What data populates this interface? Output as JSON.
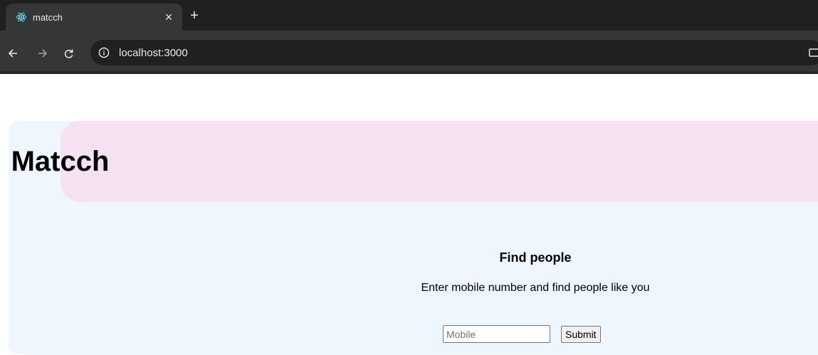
{
  "browser": {
    "tab": {
      "title": "matcch",
      "favicon": "react-icon",
      "close_glyph": "×"
    },
    "new_tab_glyph": "+",
    "nav": {
      "back_glyph": "←",
      "forward_glyph": "→",
      "reload_glyph": "C"
    },
    "address_bar": {
      "url": "localhost:3000",
      "site_info_icon": "info-icon"
    },
    "colors": {
      "tabstrip": "#1f2021",
      "toolbar": "#353638",
      "favicon": "#61dafb"
    }
  },
  "page": {
    "header": {
      "title": "Matcch"
    },
    "find_people": {
      "heading": "Find people",
      "description": "Enter mobile number and find people like you",
      "mobile_input": {
        "placeholder": "Mobile",
        "value": ""
      },
      "submit_label": "Submit"
    },
    "colors": {
      "container_bg": "#eef6fe",
      "header_bg": "#f6e1f3"
    }
  }
}
